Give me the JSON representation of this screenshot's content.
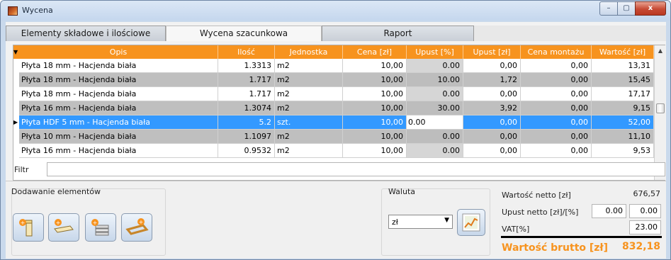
{
  "window": {
    "title": "Wycena",
    "min_label": "–",
    "max_label": "▢",
    "close_label": "x"
  },
  "tabs": [
    {
      "label": "Elementy składowe i ilościowe",
      "active": false
    },
    {
      "label": "Wycena szacunkowa",
      "active": true
    },
    {
      "label": "Raport",
      "active": false
    }
  ],
  "grid": {
    "columns": [
      "Opis",
      "Ilość",
      "Jednostka",
      "Cena [zł]",
      "Upust [%]",
      "Upust [zł]",
      "Cena montażu [zł]",
      "Wartość [zł]"
    ],
    "rows": [
      {
        "opis": "Płyta 18 mm - Hacjenda biała",
        "ilosc": "1.3313",
        "jednostka": "m2",
        "cena": "10,00",
        "upust_pct": "0.00",
        "upust_zl": "0,00",
        "montaz": "0,00",
        "wartosc": "13,31"
      },
      {
        "opis": "Płyta 18 mm - Hacjenda biała",
        "ilosc": "1.717",
        "jednostka": "m2",
        "cena": "10,00",
        "upust_pct": "10.00",
        "upust_zl": "1,72",
        "montaz": "0,00",
        "wartosc": "15,45"
      },
      {
        "opis": "Płyta 18 mm - Hacjenda biała",
        "ilosc": "1.717",
        "jednostka": "m2",
        "cena": "10,00",
        "upust_pct": "0.00",
        "upust_zl": "0,00",
        "montaz": "0,00",
        "wartosc": "17,17"
      },
      {
        "opis": "Płyta 16 mm - Hacjenda biała",
        "ilosc": "1.3074",
        "jednostka": "m2",
        "cena": "10,00",
        "upust_pct": "30.00",
        "upust_zl": "3,92",
        "montaz": "0,00",
        "wartosc": "9,15"
      },
      {
        "opis": "Płyta HDF 5 mm - Hacjenda biała",
        "ilosc": "5.2",
        "jednostka": "szt.",
        "cena": "10,00",
        "upust_pct": "0.00",
        "upust_zl": "0,00",
        "montaz": "0,00",
        "wartosc": "52,00"
      },
      {
        "opis": "Płyta 10 mm - Hacjenda biała",
        "ilosc": "1.1097",
        "jednostka": "m2",
        "cena": "10,00",
        "upust_pct": "0.00",
        "upust_zl": "0,00",
        "montaz": "0,00",
        "wartosc": "11,10"
      },
      {
        "opis": "Płyta 16 mm - Hacjenda biała",
        "ilosc": "0.9532",
        "jednostka": "m2",
        "cena": "10,00",
        "upust_pct": "0.00",
        "upust_zl": "0,00",
        "montaz": "0,00",
        "wartosc": "9,53"
      }
    ],
    "selected_row": 4
  },
  "filter": {
    "label": "Filtr",
    "value": ""
  },
  "add_elements": {
    "title": "Dodawanie elementów",
    "buttons": [
      "add-panel-icon",
      "add-shelf-icon",
      "add-board-stack-icon",
      "add-frame-icon"
    ]
  },
  "currency": {
    "title": "Waluta",
    "selected": "zł"
  },
  "summary": {
    "netto_label": "Wartość netto [zł]",
    "netto_value": "676,57",
    "upust_label": "Upust netto [zł]/[%]",
    "upust_zl": "0.00",
    "upust_pct": "0.00",
    "vat_label": "VAT[%]",
    "vat_value": "23.00",
    "brutto_label": "Wartość brutto [zł]",
    "brutto_value": "832,18"
  },
  "colors": {
    "accent": "#f7931e",
    "selection": "#3399ff"
  }
}
